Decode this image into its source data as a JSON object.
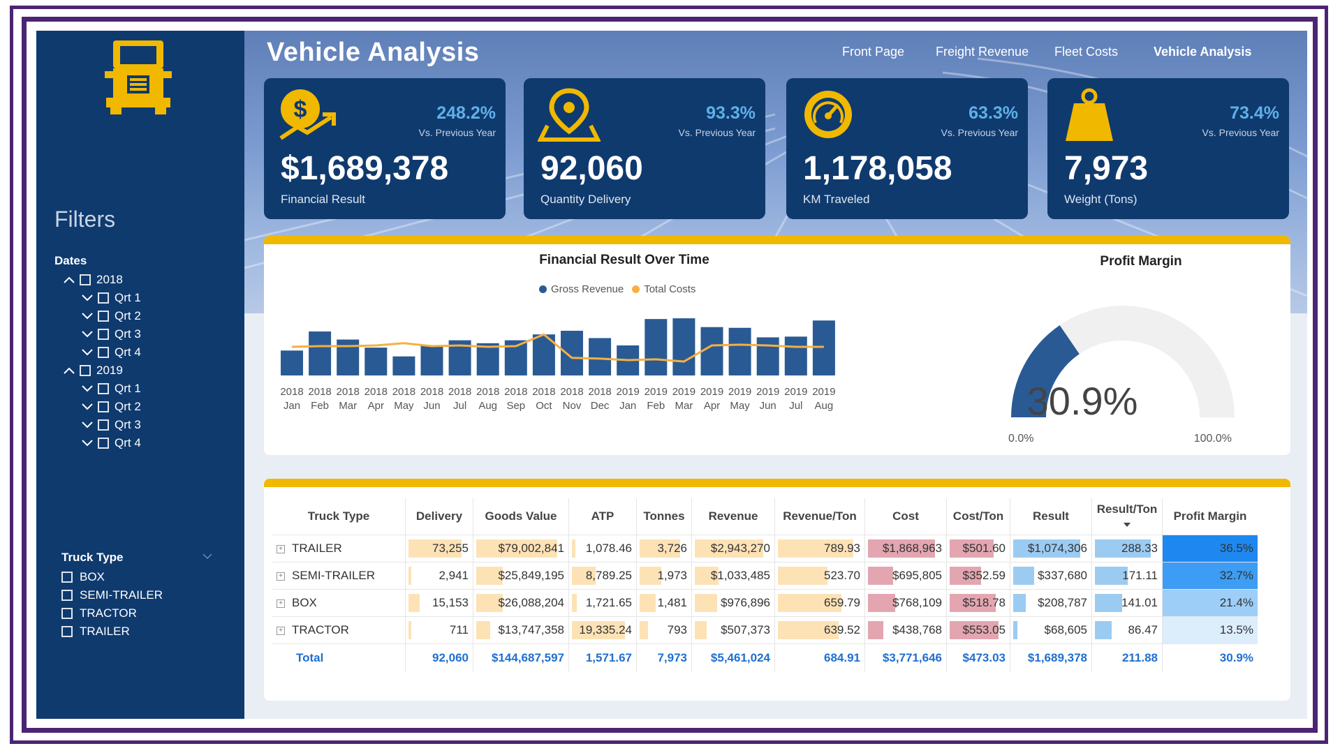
{
  "page": {
    "title": "Vehicle Analysis",
    "nav": [
      {
        "label": "Front Page",
        "active": false
      },
      {
        "label": "Freight Revenue",
        "active": false
      },
      {
        "label": "Fleet Costs",
        "active": false
      },
      {
        "label": "Vehicle Analysis",
        "active": true
      }
    ]
  },
  "colors": {
    "navy": "#0f3a6e",
    "accent_yellow": "#f1b800",
    "bar_blue": "#2a5a94",
    "line_orange": "#f5b041",
    "pct_blue": "#5fb0e8",
    "total_blue": "#1f6fd0"
  },
  "sidebar": {
    "logo_icon": "truck-icon",
    "filters_title": "Filters",
    "dates_label": "Dates",
    "tree": [
      {
        "label": "2018",
        "level": 0,
        "expanded": true
      },
      {
        "label": "Qrt 1",
        "level": 1
      },
      {
        "label": "Qrt 2",
        "level": 1
      },
      {
        "label": "Qrt 3",
        "level": 1
      },
      {
        "label": "Qrt 4",
        "level": 1
      },
      {
        "label": "2019",
        "level": 0,
        "expanded": true
      },
      {
        "label": "Qrt 1",
        "level": 1
      },
      {
        "label": "Qrt 2",
        "level": 1
      },
      {
        "label": "Qrt 3",
        "level": 1
      },
      {
        "label": "Qrt 4",
        "level": 1
      }
    ],
    "truck_type_label": "Truck Type",
    "truck_types": [
      "BOX",
      "SEMI-TRAILER",
      "TRACTOR",
      "TRAILER"
    ]
  },
  "kpis": [
    {
      "icon": "dollar-growth-icon",
      "pct": "248.2%",
      "vs": "Vs. Previous Year",
      "value": "$1,689,378",
      "label": "Financial Result"
    },
    {
      "icon": "map-pin-icon",
      "pct": "93.3%",
      "vs": "Vs. Previous Year",
      "value": "92,060",
      "label": "Quantity Delivery"
    },
    {
      "icon": "speedometer-icon",
      "pct": "63.3%",
      "vs": "Vs. Previous Year",
      "value": "1,178,058",
      "label": "KM Traveled"
    },
    {
      "icon": "weight-icon",
      "pct": "73.4%",
      "vs": "Vs. Previous Year",
      "value": "7,973",
      "label": "Weight (Tons)"
    }
  ],
  "chart_data": [
    {
      "type": "bar",
      "title": "Financial Result Over Time",
      "legend_placement": "top",
      "categories": [
        "2018 Jan",
        "2018 Feb",
        "2018 Mar",
        "2018 Apr",
        "2018 May",
        "2018 Jun",
        "2018 Jul",
        "2018 Aug",
        "2018 Sep",
        "2018 Oct",
        "2018 Nov",
        "2018 Dec",
        "2019 Jan",
        "2019 Feb",
        "2019 Mar",
        "2019 Apr",
        "2019 May",
        "2019 Jun",
        "2019 Jul",
        "2019 Aug"
      ],
      "series": [
        {
          "name": "Gross Revenue",
          "kind": "bar",
          "color": "#2a5a94",
          "values": [
            170,
            300,
            245,
            190,
            130,
            205,
            240,
            220,
            240,
            280,
            305,
            255,
            205,
            385,
            390,
            330,
            325,
            260,
            265,
            375
          ]
        },
        {
          "name": "Total Costs",
          "kind": "line",
          "color": "#f5b041",
          "values": [
            195,
            200,
            200,
            205,
            220,
            200,
            205,
            195,
            200,
            280,
            120,
            115,
            105,
            110,
            95,
            205,
            210,
            205,
            195,
            195
          ]
        }
      ],
      "grid": false
    },
    {
      "type": "gauge",
      "title": "Profit Margin",
      "value": 30.9,
      "value_label": "30.9%",
      "min_label": "0.0%",
      "max_label": "100.0%",
      "color": "#2a5a94"
    }
  ],
  "table": {
    "columns": [
      "Truck Type",
      "Delivery",
      "Goods Value",
      "ATP",
      "Tonnes",
      "Revenue",
      "Revenue/Ton",
      "Cost",
      "Cost/Ton",
      "Result",
      "Result/Ton",
      "Profit Margin"
    ],
    "rows": [
      {
        "type": "TRAILER",
        "delivery": "73,255",
        "goods": "$79,002,841",
        "atp": "1,078.46",
        "tonnes": "3,726",
        "revenue": "$2,943,270",
        "rev_ton": "789.93",
        "cost": "$1,868,963",
        "cost_ton": "$501.60",
        "result": "$1,074,306",
        "res_ton": "288.33",
        "margin": "36.5%",
        "f": {
          "delivery": 1.0,
          "goods": 1.0,
          "atp": 0.06,
          "tonnes": 1.0,
          "revenue": 1.0,
          "rev_ton": 1.0,
          "cost": 1.0,
          "cost_ton": 0.9,
          "result": 1.0,
          "res_ton": 1.0
        }
      },
      {
        "type": "SEMI-TRAILER",
        "delivery": "2,941",
        "goods": "$25,849,195",
        "atp": "8,789.25",
        "tonnes": "1,973",
        "revenue": "$1,033,485",
        "rev_ton": "523.70",
        "cost": "$695,805",
        "cost_ton": "$352.59",
        "result": "$337,680",
        "res_ton": "171.11",
        "margin": "32.7%",
        "f": {
          "delivery": 0.04,
          "goods": 0.33,
          "atp": 0.45,
          "tonnes": 0.53,
          "revenue": 0.35,
          "rev_ton": 0.66,
          "cost": 0.37,
          "cost_ton": 0.64,
          "result": 0.31,
          "res_ton": 0.59
        }
      },
      {
        "type": "BOX",
        "delivery": "15,153",
        "goods": "$26,088,204",
        "atp": "1,721.65",
        "tonnes": "1,481",
        "revenue": "$976,896",
        "rev_ton": "659.79",
        "cost": "$768,109",
        "cost_ton": "$518.78",
        "result": "$208,787",
        "res_ton": "141.01",
        "margin": "21.4%",
        "f": {
          "delivery": 0.21,
          "goods": 0.33,
          "atp": 0.09,
          "tonnes": 0.4,
          "revenue": 0.33,
          "rev_ton": 0.84,
          "cost": 0.41,
          "cost_ton": 0.94,
          "result": 0.19,
          "res_ton": 0.49
        }
      },
      {
        "type": "TRACTOR",
        "delivery": "711",
        "goods": "$13,747,358",
        "atp": "19,335.24",
        "tonnes": "793",
        "revenue": "$507,373",
        "rev_ton": "639.52",
        "cost": "$438,768",
        "cost_ton": "$553.05",
        "result": "$68,605",
        "res_ton": "86.47",
        "margin": "13.5%",
        "f": {
          "delivery": 0.01,
          "goods": 0.17,
          "atp": 1.0,
          "tonnes": 0.21,
          "revenue": 0.17,
          "rev_ton": 0.81,
          "cost": 0.23,
          "cost_ton": 1.0,
          "result": 0.06,
          "res_ton": 0.3
        }
      }
    ],
    "total": {
      "type": "Total",
      "delivery": "92,060",
      "goods": "$144,687,597",
      "atp": "1,571.67",
      "tonnes": "7,973",
      "revenue": "$5,461,024",
      "rev_ton": "684.91",
      "cost": "$3,771,646",
      "cost_ton": "$473.03",
      "result": "$1,689,378",
      "res_ton": "211.88",
      "margin": "30.9%"
    },
    "margin_colors": [
      "#1e88f0",
      "#3d9cf3",
      "#9ccef8",
      "#dcedfc"
    ]
  }
}
